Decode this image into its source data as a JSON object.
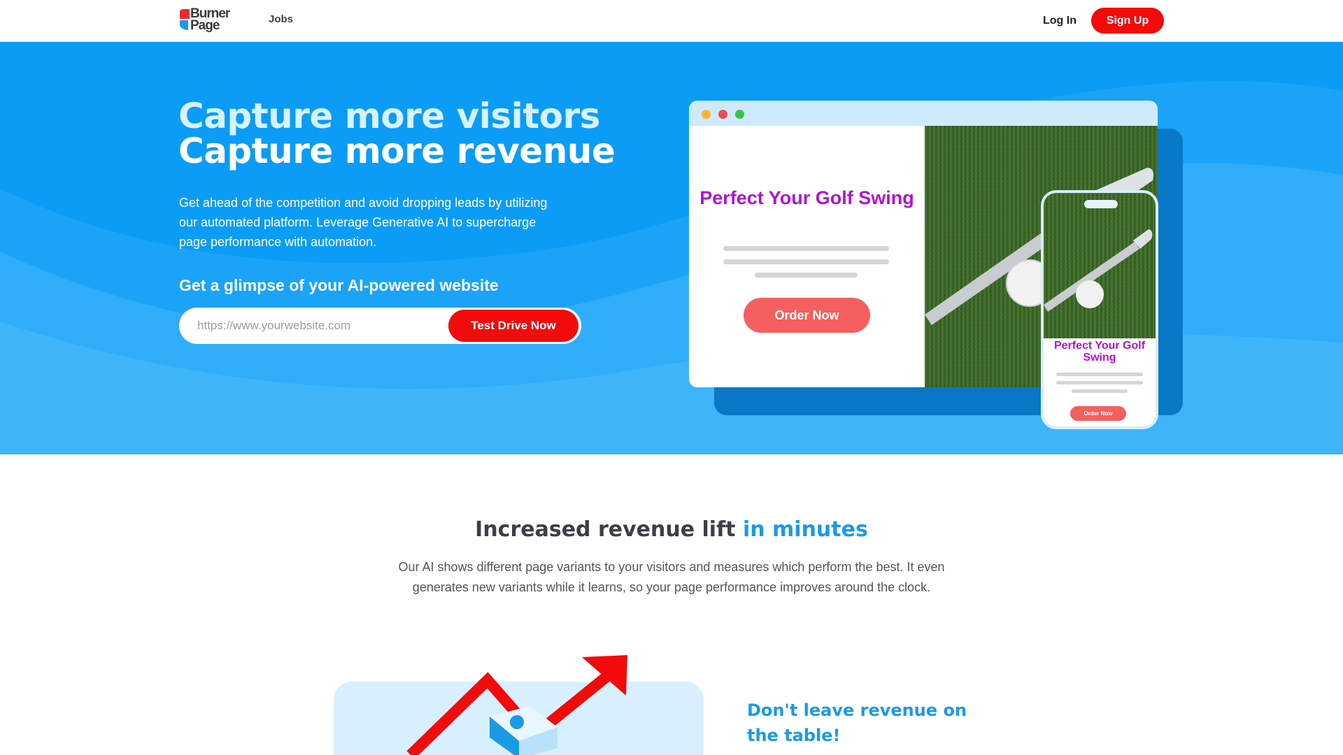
{
  "nav": {
    "logo_text_line1": "Burner",
    "logo_text_line2": "Page",
    "jobs": "Jobs",
    "login": "Log In",
    "signup": "Sign Up"
  },
  "hero": {
    "title_line1": "Capture more visitors",
    "title_line2": "Capture more revenue",
    "description": "Get ahead of the competition and avoid dropping leads by utilizing our automated platform. Leverage Generative AI to supercharge page performance with automation.",
    "glimpse": "Get a glimpse of your AI-powered website",
    "input_placeholder": "https://www.yourwebsite.com",
    "cta": "Test Drive Now"
  },
  "mockup": {
    "heading": "Perfect Your Golf Swing",
    "order_button": "Order Now",
    "phone_heading": "Perfect Your Golf Swing",
    "phone_order_button": "Order Now",
    "dot_colors": [
      "#f5b731",
      "#ee4c4c",
      "#3cc04c"
    ]
  },
  "revenue": {
    "title_main": "Increased revenue lift",
    "title_highlight": "in minutes",
    "description": "Our AI shows different page variants to your visitors and measures which perform the best. It even generates new variants while it learns, so your page performance improves around the clock.",
    "side_title": "Don't leave revenue on the table!"
  },
  "colors": {
    "brand_blue": "#0b9cf6",
    "brand_red": "#f10b0b",
    "accent_purple": "#b012d4",
    "highlight_blue": "#1a9ae6"
  }
}
